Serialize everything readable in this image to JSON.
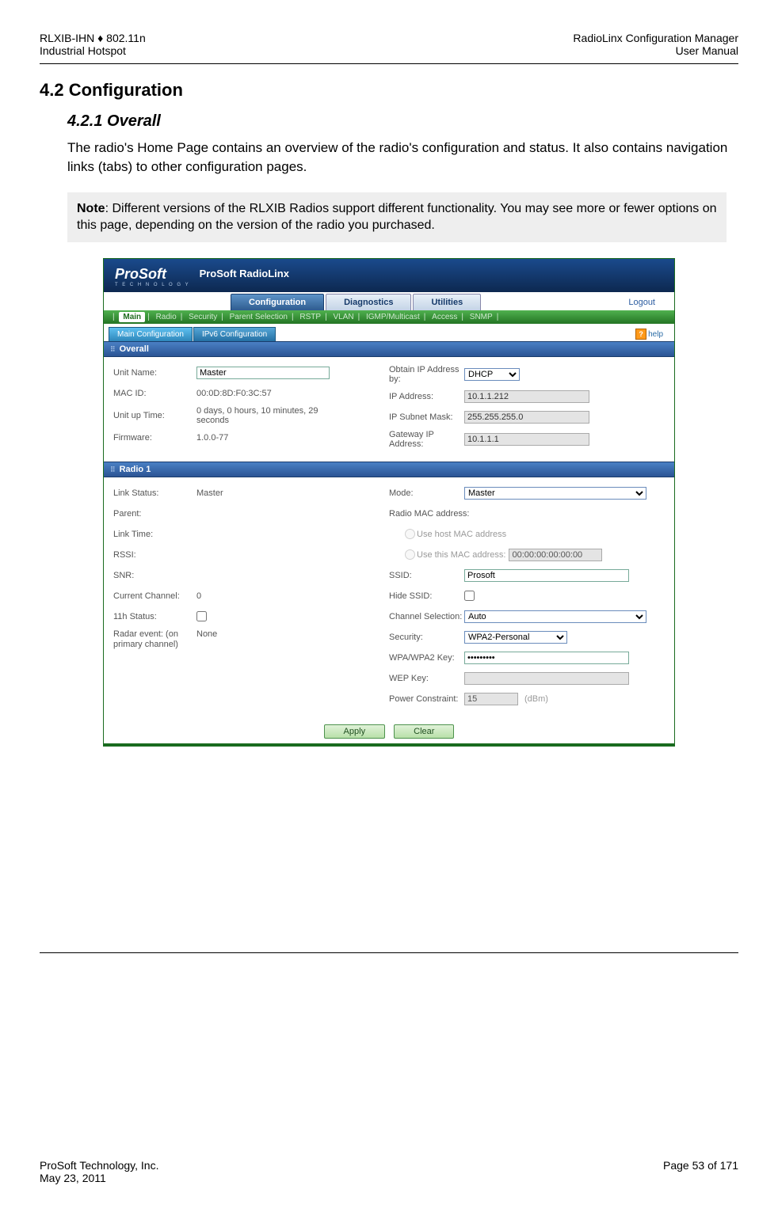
{
  "header": {
    "left1": "RLXIB-IHN ♦ 802.11n",
    "left2": "Industrial Hotspot",
    "right1": "RadioLinx Configuration Manager",
    "right2": "User Manual"
  },
  "section": {
    "num_title": "4.2     Configuration",
    "sub_num_title": "4.2.1   Overall",
    "body": "The radio's Home Page contains an overview of the radio's configuration and status. It also contains navigation links (tabs) to other configuration pages.",
    "note_prefix": "Note",
    "note": ": Different versions of the RLXIB Radios support different functionality. You may see more or fewer options on this page, depending on the version of the radio you purchased."
  },
  "ss": {
    "brand": "ProSoft",
    "brand_sub": "T E C H N O L O G Y",
    "title": "ProSoft RadioLinx",
    "tabs": {
      "cfg": "Configuration",
      "diag": "Diagnostics",
      "util": "Utilities"
    },
    "logout": "Logout",
    "subtabs": [
      "Main",
      "Radio",
      "Security",
      "Parent Selection",
      "RSTP",
      "VLAN",
      "IGMP/Multicast",
      "Access",
      "SNMP"
    ],
    "cfgtabs": {
      "main": "Main Configuration",
      "ipv6": "IPv6 Configuration"
    },
    "help": "help",
    "panels": {
      "overall": "Overall",
      "radio1": "Radio 1"
    },
    "overall": {
      "labels": {
        "unit_name": "Unit Name:",
        "mac_id": "MAC ID:",
        "uptime": "Unit up Time:",
        "firmware": "Firmware:",
        "obtain_ip": "Obtain IP Address by:",
        "ip_addr": "IP Address:",
        "subnet": "IP Subnet Mask:",
        "gateway": "Gateway IP Address:"
      },
      "values": {
        "unit_name": "Master",
        "mac_id": "00:0D:8D:F0:3C:57",
        "uptime": "0 days, 0 hours, 10 minutes, 29 seconds",
        "firmware": "1.0.0-77",
        "obtain_ip": "DHCP",
        "ip_addr": "10.1.1.212",
        "subnet": "255.255.255.0",
        "gateway": "10.1.1.1"
      }
    },
    "radio1": {
      "labels": {
        "link_status": "Link Status:",
        "parent": "Parent:",
        "link_time": "Link Time:",
        "rssi": "RSSI:",
        "snr": "SNR:",
        "cur_ch": "Current Channel:",
        "s11h": "11h Status:",
        "radar": "Radar event: (on primary channel)",
        "mode": "Mode:",
        "radio_mac": "Radio MAC address:",
        "use_host": "Use host MAC address",
        "use_this": "Use this MAC address:",
        "ssid": "SSID:",
        "hide_ssid": "Hide SSID:",
        "chan_sel": "Channel Selection:",
        "security": "Security:",
        "wpa_key": "WPA/WPA2 Key:",
        "wep_key": "WEP Key:",
        "power": "Power Constraint:",
        "dbm": "(dBm)"
      },
      "values": {
        "link_status": "Master",
        "cur_ch": "0",
        "radar": "None",
        "mode": "Master",
        "use_this_mac": "00:00:00:00:00:00",
        "ssid": "Prosoft",
        "chan_sel": "Auto",
        "security": "WPA2-Personal",
        "wpa_key": "•••••••••",
        "power": "15"
      }
    },
    "buttons": {
      "apply": "Apply",
      "clear": "Clear"
    }
  },
  "footer": {
    "left1": "ProSoft Technology, Inc.",
    "left2": "May 23, 2011",
    "right": "Page 53 of 171"
  }
}
